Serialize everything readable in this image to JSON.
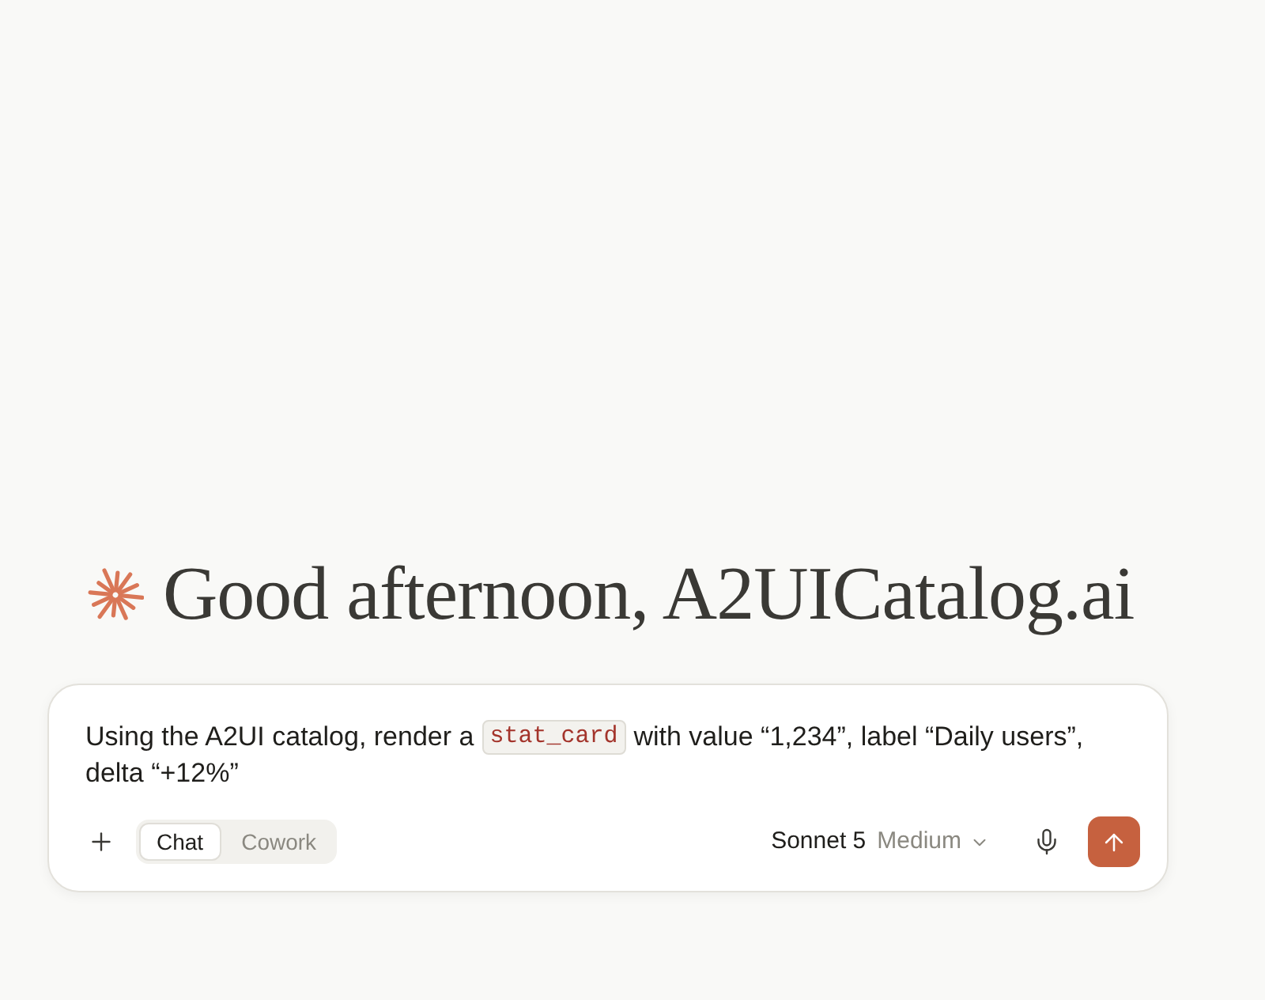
{
  "greeting": {
    "text": "Good afternoon, A2UICatalog.ai"
  },
  "composer": {
    "message_lines": [
      [
        {
          "kind": "text",
          "text": "Using the A2UI catalog, render a"
        },
        {
          "kind": "code",
          "text": "stat_card"
        },
        {
          "kind": "text",
          "text": "with value “1,234”, label “Daily users”,"
        }
      ],
      [
        {
          "kind": "text",
          "text": "delta “+12%”"
        }
      ]
    ],
    "mode_toggle": [
      {
        "label": "Chat",
        "selected": true
      },
      {
        "label": "Cowork",
        "selected": false
      }
    ],
    "model": "Sonnet 5",
    "effort": "Medium"
  }
}
